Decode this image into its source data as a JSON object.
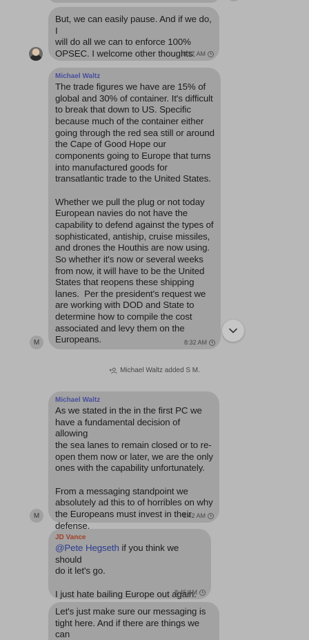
{
  "messages": [
    {
      "id": "msg1",
      "sender": "",
      "text": "But, we can easily pause. And if we do, I\nwill do all we can to enforce 100%\nOPSEC. I welcome other thoughts.",
      "time": "8:27 AM",
      "avatar": "photo"
    },
    {
      "id": "msg2",
      "sender": "Michael Waltz",
      "sender_color": "#4a4f9e",
      "text": "The trade figures we have are 15% of\nglobal and 30% of container. It's difficult\nto break that down to US. Specific\nbecause much of the container either\ngoing through the red sea still or around\nthe Cape of Good Hope our\ncomponents going to Europe that turns\ninto manufactured goods for\ntransatlantic trade to the United States.\n\nWhether we pull the plug or not today\nEuropean navies do not have the\ncapability to defend against the types of\nsophisticated, antiship, cruise missiles,\nand drones the Houthis are now using.\nSo whether it's now or several weeks\nfrom now, it will have to be the United\nStates that reopens these shipping\nlanes.  Per the president's request we\nare working with DOD and State to\ndetermine how to compile the cost\nassociated and levy them on the\nEuropeans.",
      "time": "8:32 AM",
      "avatar_initial": "M"
    },
    {
      "id": "msg3",
      "sender": "Michael Waltz",
      "sender_color": "#4a4f9e",
      "text": "As we stated in the in the first PC we\nhave a fundamental decision of allowing\nthe sea lanes to remain closed or to re-\nopen them now or later, we are the only\nones with the capability unfortunately.\n\nFrom a messaging standpoint we\nabsolutely ad this to of horribles on why\nthe Europeans must invest in their\ndefense.",
      "time": "8:42 AM",
      "avatar_initial": "M"
    },
    {
      "id": "msg4",
      "sender": "JD Vance",
      "sender_color": "#a0402a",
      "mention": "@Pete Hegseth",
      "text_after_mention": " if you think we should\ndo it let's go.\n\nI just hate bailing Europe out again.",
      "time": "8:45 AM"
    },
    {
      "id": "msg5",
      "sender": "",
      "text": "Let's just make sure our messaging is\ntight here. And if there are things we can\ndo upfront to minimize risk to Saudi oil"
    }
  ],
  "system_note": "Michael Waltz added S M.",
  "icons": {
    "scroll_down": "chevron-down-icon",
    "clock": "clock-icon",
    "person_add": "person-add-icon"
  },
  "colors": {
    "background": "#b8b8b8",
    "bubble": "#a2a2a2",
    "waltz_name": "#4a4f9e",
    "vance_name": "#a0402a",
    "mention": "#2a3b8f"
  }
}
